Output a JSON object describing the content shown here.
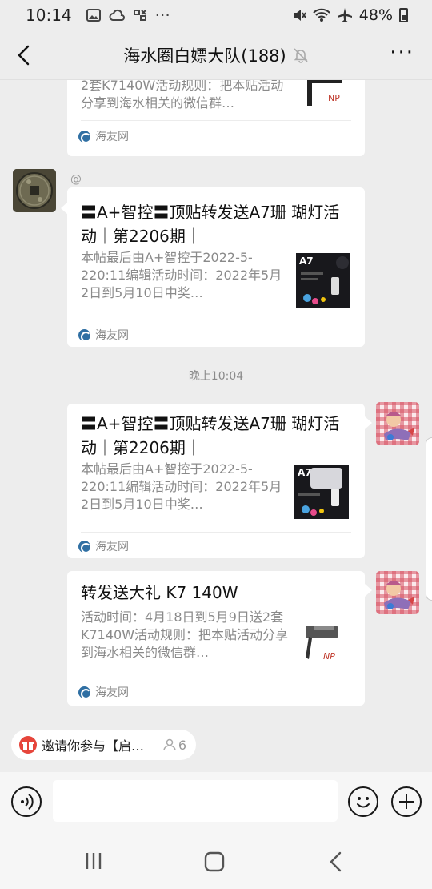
{
  "status_bar": {
    "time": "10:14",
    "dots": "···",
    "battery_percent": "48%"
  },
  "header": {
    "title": "海水圈白嫖大队(188)",
    "more": "···"
  },
  "messages": [
    {
      "side": "left",
      "partial": true,
      "desc": "2套K7140W活动规则：把本贴活动分享到海水相关的微信群…",
      "source": "海友网"
    },
    {
      "side": "left",
      "sender": "@",
      "title": "〓A+智控〓顶贴转发送A7珊 瑚灯活动｜第2206期｜",
      "desc": "本帖最后由A+智控于2022-5-220:11编辑活动时间：2022年5月2日到5月10日中奖…",
      "thumb_label": "A7",
      "source": "海友网"
    },
    {
      "timestamp": "晚上10:04"
    },
    {
      "side": "right",
      "title": "〓A+智控〓顶贴转发送A7珊 瑚灯活动｜第2206期｜",
      "desc": "本帖最后由A+智控于2022-5-220:11编辑活动时间：2022年5月2日到5月10日中奖…",
      "thumb_label": "A7",
      "source": "海友网"
    },
    {
      "side": "right",
      "title": "转发送大礼 K7 140W",
      "desc": "活动时间：4月18日到5月9日送2套K7140W活动规则：把本贴活动分享到海水相关的微信群…",
      "source": "海友网"
    }
  ],
  "pinned": {
    "text": "邀请你参与【启…",
    "count": "6"
  },
  "input": {
    "placeholder": ""
  },
  "colors": {
    "background": "#ededed",
    "bubble": "#ffffff",
    "pinned_icon": "#e6453b"
  }
}
